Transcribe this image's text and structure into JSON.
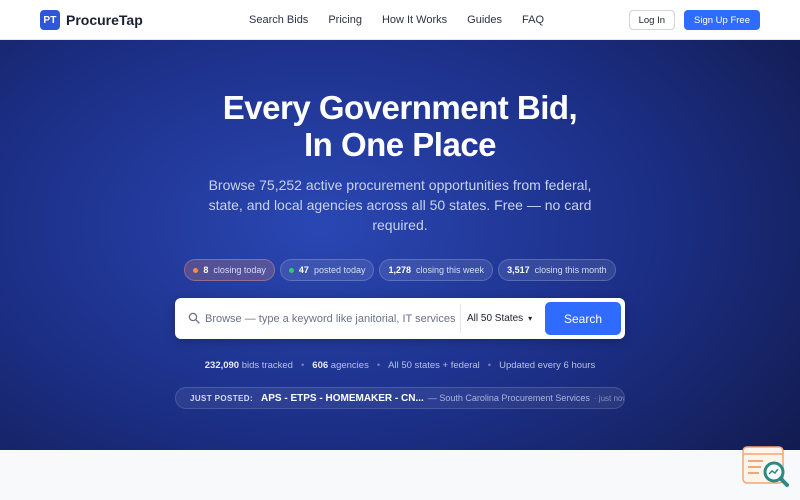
{
  "brand": {
    "mark": "PT",
    "name": "ProcureTap"
  },
  "nav": {
    "links": [
      "Search Bids",
      "Pricing",
      "How It Works",
      "Guides",
      "FAQ"
    ],
    "login": "Log In",
    "signup": "Sign Up Free"
  },
  "hero": {
    "title_line1": "Every Government Bid,",
    "title_line2": "In One Place",
    "subtitle": "Browse 75,252 active procurement opportunities from federal, state, and local agencies across all 50 states. Free — no card required."
  },
  "pills": [
    {
      "count": "8",
      "label": "closing today",
      "dot": "#ff8a4c"
    },
    {
      "count": "47",
      "label": "posted today",
      "dot": "#2ecc71"
    },
    {
      "count": "1,278",
      "label": "closing this week"
    },
    {
      "count": "3,517",
      "label": "closing this month"
    }
  ],
  "search": {
    "placeholder": "Browse — type a keyword like janitorial, IT services, roofing",
    "state": "All 50 States",
    "button": "Search"
  },
  "stats": {
    "bids_count": "232,090",
    "bids_label": "bids tracked",
    "agencies_count": "606",
    "agencies_label": "agencies",
    "coverage": "All 50 states + federal",
    "update": "Updated every 6 hours"
  },
  "just_posted": {
    "label": "JUST POSTED:",
    "title": "APS - ETPS - HOMEMAKER - CN...",
    "agency": "— South Carolina Procurement Services",
    "time": "· just now"
  },
  "colors": {
    "accent": "#2f6bff",
    "hero_dark": "#131d54",
    "hot": "#ff8a4c",
    "new": "#2ecc71"
  },
  "icons": {
    "search": "search-icon",
    "chat_widget": "chat-search-widget-icon"
  }
}
